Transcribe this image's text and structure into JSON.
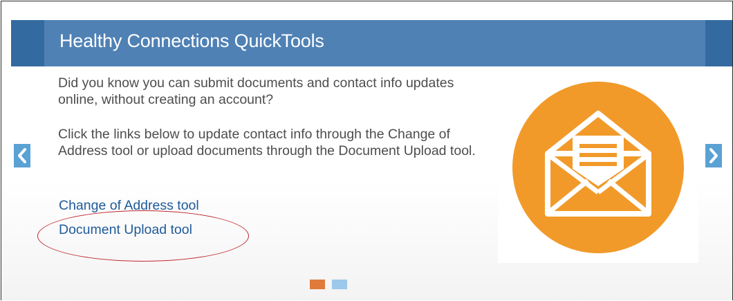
{
  "panel": {
    "title": "Healthy Connections QuickTools",
    "intro_text": "Did you know you can submit documents and contact info updates online, without creating an account?",
    "instructions_text": "Click the links below to update contact info through the Change of Address tool or upload documents through the Document Upload tool.",
    "links": [
      {
        "label": "Change of Address tool"
      },
      {
        "label": "Document Upload tool"
      }
    ]
  },
  "image": {
    "icon": "envelope-icon"
  },
  "carousel": {
    "prev_icon": "chevron-left-icon",
    "next_icon": "chevron-right-icon",
    "slide_count": 2,
    "active_slide": 1
  },
  "colors": {
    "header_blue": "#4f81b5",
    "header_dark_blue": "#336aa0",
    "link_blue": "#1f5a9a",
    "orange": "#f19a2a",
    "arrow_blue": "#5aa1d4",
    "active_dot": "#e07a3a",
    "inactive_dot": "#9cc8ea",
    "annotation_red": "#c0262d"
  }
}
